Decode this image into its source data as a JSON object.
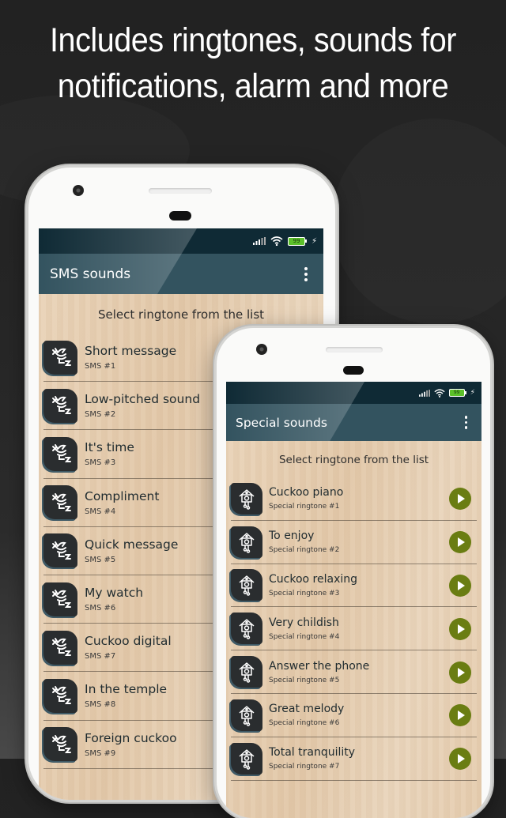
{
  "headline": {
    "line1": "Includes ringtones, sounds for",
    "line2": "notifications, alarm and more"
  },
  "status": {
    "battery": "99",
    "icons": [
      "signal-icon",
      "wifi-icon",
      "battery-icon",
      "charging-icon"
    ]
  },
  "colors": {
    "statusbar": "#0f2a35",
    "appbar": "#33535f",
    "play_button": "#6a7d12",
    "battery_green": "#5cc02a"
  },
  "phone1": {
    "title": "SMS sounds",
    "select_label": "Select ringtone from the list",
    "items": [
      {
        "name": "Short message",
        "sub": "SMS #1"
      },
      {
        "name": "Low-pitched sound",
        "sub": "SMS #2"
      },
      {
        "name": "It's time",
        "sub": "SMS #3"
      },
      {
        "name": "Compliment",
        "sub": "SMS #4"
      },
      {
        "name": "Quick message",
        "sub": "SMS #5"
      },
      {
        "name": "My watch",
        "sub": "SMS #6"
      },
      {
        "name": "Cuckoo digital",
        "sub": "SMS #7"
      },
      {
        "name": "In the temple",
        "sub": "SMS #8"
      },
      {
        "name": "Foreign cuckoo",
        "sub": "SMS #9"
      }
    ]
  },
  "phone2": {
    "title": "Special sounds",
    "select_label": "Select ringtone from the list",
    "items": [
      {
        "name": "Cuckoo piano",
        "sub": "Special ringtone #1"
      },
      {
        "name": "To enjoy",
        "sub": "Special ringtone #2"
      },
      {
        "name": "Cuckoo relaxing",
        "sub": "Special ringtone #3"
      },
      {
        "name": "Very childish",
        "sub": "Special ringtone #4"
      },
      {
        "name": "Answer the phone",
        "sub": "Special ringtone #5"
      },
      {
        "name": "Great melody",
        "sub": "Special ringtone #6"
      },
      {
        "name": "Total tranquility",
        "sub": "Special ringtone #7"
      }
    ]
  }
}
